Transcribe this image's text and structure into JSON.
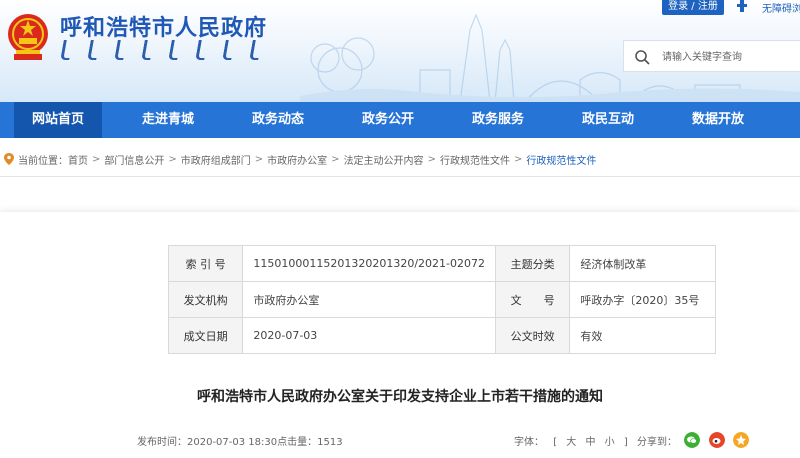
{
  "header": {
    "site_title": "呼和浩特市人民政府",
    "login_label": "登录 / 注册",
    "accessibility_label": "无障碍浏",
    "search_placeholder": "请输入关键字查询"
  },
  "nav": {
    "items": [
      {
        "label": "网站首页",
        "active": true
      },
      {
        "label": "走进青城",
        "active": false
      },
      {
        "label": "政务动态",
        "active": false
      },
      {
        "label": "政务公开",
        "active": false
      },
      {
        "label": "政务服务",
        "active": false
      },
      {
        "label": "政民互动",
        "active": false
      },
      {
        "label": "数据开放",
        "active": false
      }
    ]
  },
  "breadcrumb": {
    "prefix": "当前位置：",
    "items": [
      "首页",
      "部门信息公开",
      "市政府组成部门",
      "市政府办公室",
      "法定主动公开内容",
      "行政规范性文件",
      "行政规范性文件"
    ]
  },
  "meta_table": {
    "rows": [
      {
        "k1": "索 引 号",
        "v1": "115010001152013202013​20/2021-02072",
        "k2": "主题分类",
        "v2": "经济体制改革"
      },
      {
        "k1": "发文机构",
        "v1": "市政府办公室",
        "k2": "文　　号",
        "v2": "呼政办字〔2020〕35号"
      },
      {
        "k1": "成文日期",
        "v1": "2020-07-03",
        "k2": "公文时效",
        "v2": "有效"
      }
    ]
  },
  "document": {
    "title": "呼和浩特市人民政府办公室关于印发支持企业上市若干措施的通知",
    "publish_label": "发布时间：",
    "publish_time": "2020-07-03 18:30",
    "views_label": "点击量：",
    "views": "1513",
    "fontsize_label": "字体：",
    "fontsize_options": [
      "[",
      "大",
      "中",
      "小",
      "]"
    ],
    "share_label": "分享到："
  },
  "colors": {
    "brand_blue": "#2574d6",
    "nav_active": "#1456ad",
    "title_blue": "#1f59b5"
  },
  "icons": {
    "emblem": "national-emblem",
    "search": "search-icon",
    "location": "location-pin-icon",
    "share": [
      "wechat-icon",
      "weibo-icon",
      "qzone-icon"
    ]
  }
}
